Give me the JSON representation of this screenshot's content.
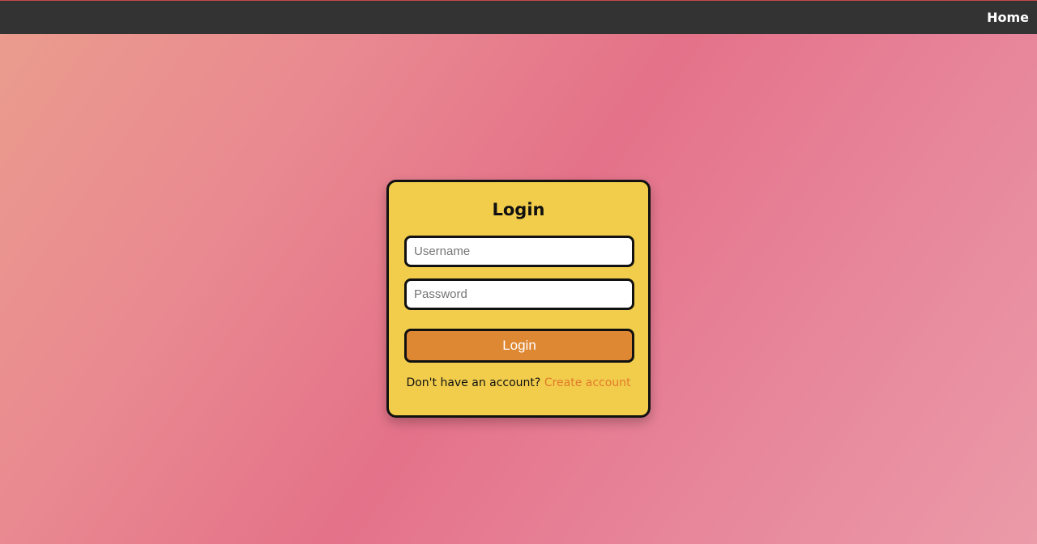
{
  "nav": {
    "home_label": "Home"
  },
  "login_card": {
    "title": "Login",
    "username_placeholder": "Username",
    "password_placeholder": "Password",
    "submit_label": "Login",
    "signup_prompt": "Don't have an account?",
    "signup_link": "Create account"
  },
  "colors": {
    "topbar": "#333333",
    "card_background": "#f2cd4b",
    "button": "#df8834",
    "link": "#e07b2b",
    "border": "#111111"
  }
}
